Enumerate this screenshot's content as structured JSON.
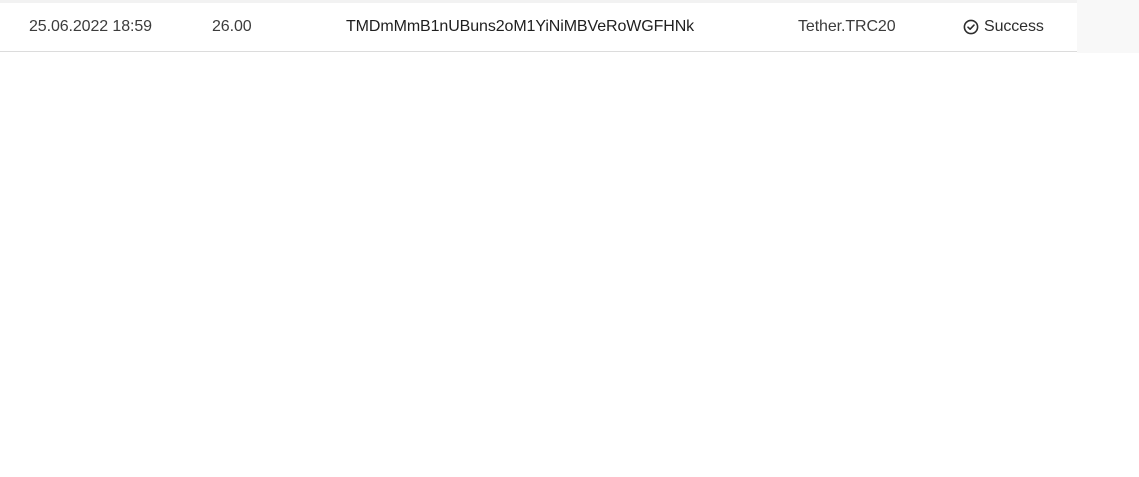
{
  "transactions": {
    "rows": [
      {
        "date": "25.06.2022 18:59",
        "amount": "26.00",
        "address": "TMDmMmB1nUBuns2oM1YiNiMBVeRoWGFHNk",
        "currency": "Tether.TRC20",
        "status": "Success",
        "status_icon": "check-circle-icon"
      }
    ]
  }
}
